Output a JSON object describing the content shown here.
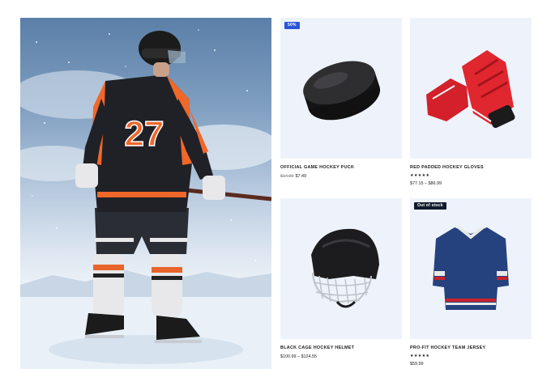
{
  "hero": {
    "jersey_number": "27"
  },
  "products": [
    {
      "title": "Official Game Hockey Puck",
      "badge": "50%",
      "badge_color": "#2b55d6",
      "rating": "",
      "old_price": "$14.99",
      "price": "$7.49",
      "image": "hockey-puck-icon"
    },
    {
      "title": "Red Padded Hockey Gloves",
      "badge": "",
      "badge_color": "",
      "rating": "★★★★★",
      "old_price": "",
      "price": "$77.15 – $86.99",
      "image": "hockey-gloves-icon"
    },
    {
      "title": "Black Cage Hockey Helmet",
      "badge": "",
      "badge_color": "",
      "rating": "",
      "old_price": "",
      "price": "$100.99 – $124.55",
      "image": "hockey-helmet-icon"
    },
    {
      "title": "Pro-Fit Hockey Team Jersey",
      "badge": "Out of stock",
      "badge_color": "#111a2e",
      "rating": "★★★★★",
      "old_price": "",
      "price": "$59.99",
      "image": "hockey-jersey-icon"
    }
  ],
  "colors": {
    "card_bg": "#eef3fb",
    "accent_orange": "#f0672a",
    "sale_blue": "#2b55d6"
  }
}
